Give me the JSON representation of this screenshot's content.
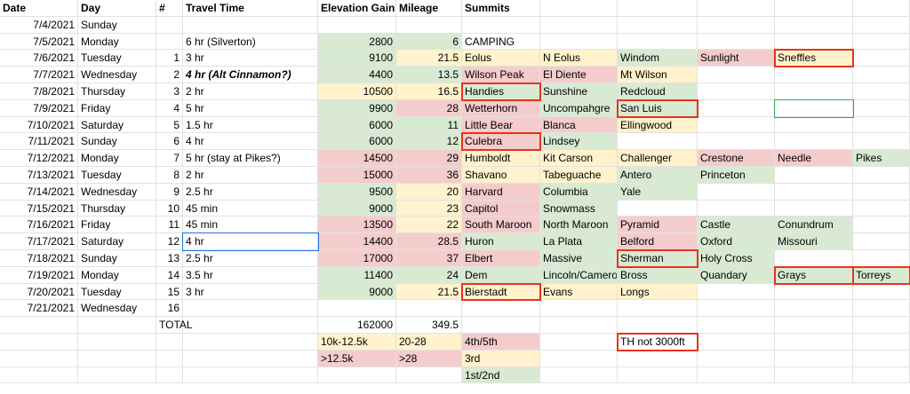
{
  "colors": {
    "green": "#d9ead3",
    "yellow": "#fff2cc",
    "red": "#f4cccc",
    "highlight_border": "#e8321f",
    "selected_border": "#1a73e8",
    "empty_box_border": "#34a853"
  },
  "headers": [
    "Date",
    "Day",
    "#",
    "Travel Time",
    "Elevation Gain",
    "Mileage",
    "Summits"
  ],
  "rows": [
    {
      "date": "7/4/2021",
      "day": "Sunday",
      "n": "",
      "travel": "",
      "elev": "",
      "miles": "",
      "summits": []
    },
    {
      "date": "7/5/2021",
      "day": "Monday",
      "n": "",
      "travel": "6 hr (Silverton)",
      "elev": "2800",
      "elev_c": "green",
      "miles": "6",
      "miles_c": "green",
      "summits": [
        {
          "t": "CAMPING",
          "c": ""
        }
      ]
    },
    {
      "date": "7/6/2021",
      "day": "Tuesday",
      "n": "1",
      "travel": "3 hr",
      "elev": "9100",
      "elev_c": "green",
      "miles": "21.5",
      "miles_c": "yellow",
      "summits": [
        {
          "t": "Eolus",
          "c": "yellow"
        },
        {
          "t": "N Eolus",
          "c": "yellow"
        },
        {
          "t": "Windom",
          "c": "green"
        },
        {
          "t": "Sunlight",
          "c": "red"
        },
        {
          "t": "Sneffles",
          "c": "yellow",
          "box": true
        }
      ]
    },
    {
      "date": "7/7/2021",
      "day": "Wednesday",
      "n": "2",
      "travel": "4 hr (Alt Cinnamon?)",
      "travel_bi": true,
      "elev": "4400",
      "elev_c": "green",
      "miles": "13.5",
      "miles_c": "green",
      "summits": [
        {
          "t": "Wilson Peak",
          "c": "red"
        },
        {
          "t": "El Diente",
          "c": "red"
        },
        {
          "t": "Mt Wilson",
          "c": "yellow"
        }
      ]
    },
    {
      "date": "7/8/2021",
      "day": "Thursday",
      "n": "3",
      "travel": "2 hr",
      "elev": "10500",
      "elev_c": "yellow",
      "miles": "16.5",
      "miles_c": "yellow",
      "summits": [
        {
          "t": "Handies",
          "c": "green",
          "box": true
        },
        {
          "t": "Sunshine",
          "c": "green"
        },
        {
          "t": "Redcloud",
          "c": "green"
        }
      ]
    },
    {
      "date": "7/9/2021",
      "day": "Friday",
      "n": "4",
      "travel": "5 hr",
      "elev": "9900",
      "elev_c": "green",
      "miles": "28",
      "miles_c": "red",
      "summits": [
        {
          "t": "Wetterhorn",
          "c": "red"
        },
        {
          "t": "Uncompahgre",
          "c": "green"
        },
        {
          "t": "San Luis",
          "c": "green",
          "box": true
        },
        {
          "t": "",
          "c": ""
        },
        {
          "t": "",
          "c": "",
          "gbox": true
        }
      ]
    },
    {
      "date": "7/10/2021",
      "day": "Saturday",
      "n": "5",
      "travel": "1.5 hr",
      "elev": "6000",
      "elev_c": "green",
      "miles": "11",
      "miles_c": "green",
      "summits": [
        {
          "t": "Little Bear",
          "c": "red"
        },
        {
          "t": "Blanca",
          "c": "red"
        },
        {
          "t": "Ellingwood",
          "c": "yellow"
        }
      ]
    },
    {
      "date": "7/11/2021",
      "day": "Sunday",
      "n": "6",
      "travel": "4 hr",
      "elev": "6000",
      "elev_c": "green",
      "miles": "12",
      "miles_c": "green",
      "summits": [
        {
          "t": "Culebra",
          "c": "red",
          "box": true
        },
        {
          "t": "Lindsey",
          "c": "green"
        }
      ]
    },
    {
      "date": "7/12/2021",
      "day": "Monday",
      "n": "7",
      "travel": "5 hr (stay at Pikes?)",
      "elev": "14500",
      "elev_c": "red",
      "miles": "29",
      "miles_c": "red",
      "summits": [
        {
          "t": "Humboldt",
          "c": "yellow"
        },
        {
          "t": "Kit Carson",
          "c": "yellow"
        },
        {
          "t": "Challenger",
          "c": "yellow"
        },
        {
          "t": "Crestone",
          "c": "red"
        },
        {
          "t": "Needle",
          "c": "red"
        },
        {
          "t": "Pikes",
          "c": "green"
        }
      ]
    },
    {
      "date": "7/13/2021",
      "day": "Tuesday",
      "n": "8",
      "travel": "2 hr",
      "elev": "15000",
      "elev_c": "red",
      "miles": "36",
      "miles_c": "red",
      "summits": [
        {
          "t": "Shavano",
          "c": "yellow"
        },
        {
          "t": "Tabeguache",
          "c": "yellow"
        },
        {
          "t": "Antero",
          "c": "green"
        },
        {
          "t": "Princeton",
          "c": "green"
        }
      ]
    },
    {
      "date": "7/14/2021",
      "day": "Wednesday",
      "n": "9",
      "travel": "2.5 hr",
      "elev": "9500",
      "elev_c": "green",
      "miles": "20",
      "miles_c": "yellow",
      "summits": [
        {
          "t": "Harvard",
          "c": "red"
        },
        {
          "t": "Columbia",
          "c": "green"
        },
        {
          "t": "Yale",
          "c": "green"
        }
      ]
    },
    {
      "date": "7/15/2021",
      "day": "Thursday",
      "n": "10",
      "travel": "45 min",
      "elev": "9000",
      "elev_c": "green",
      "miles": "23",
      "miles_c": "yellow",
      "summits": [
        {
          "t": "Capitol",
          "c": "red"
        },
        {
          "t": "Snowmass",
          "c": "green"
        }
      ]
    },
    {
      "date": "7/16/2021",
      "day": "Friday",
      "n": "11",
      "travel": "45 min",
      "elev": "13500",
      "elev_c": "red",
      "miles": "22",
      "miles_c": "yellow",
      "summits": [
        {
          "t": "South Maroon",
          "c": "red"
        },
        {
          "t": "North Maroon",
          "c": "green"
        },
        {
          "t": "Pyramid",
          "c": "red"
        },
        {
          "t": "Castle",
          "c": "green"
        },
        {
          "t": "Conundrum",
          "c": "green"
        }
      ]
    },
    {
      "date": "7/17/2021",
      "day": "Saturday",
      "n": "12",
      "travel": "4 hr",
      "travel_sel": true,
      "elev": "14400",
      "elev_c": "red",
      "miles": "28.5",
      "miles_c": "red",
      "summits": [
        {
          "t": "Huron",
          "c": "green"
        },
        {
          "t": "La Plata",
          "c": "green"
        },
        {
          "t": "Belford",
          "c": "red"
        },
        {
          "t": "Oxford",
          "c": "green"
        },
        {
          "t": "Missouri",
          "c": "green"
        }
      ]
    },
    {
      "date": "7/18/2021",
      "day": "Sunday",
      "n": "13",
      "travel": "2.5 hr",
      "elev": "17000",
      "elev_c": "red",
      "miles": "37",
      "miles_c": "red",
      "summits": [
        {
          "t": "Elbert",
          "c": "red"
        },
        {
          "t": "Massive",
          "c": "green"
        },
        {
          "t": "Sherman",
          "c": "green",
          "box": true
        },
        {
          "t": "Holy Cross",
          "c": "green"
        }
      ]
    },
    {
      "date": "7/19/2021",
      "day": "Monday",
      "n": "14",
      "travel": "3.5 hr",
      "elev": "11400",
      "elev_c": "green",
      "miles": "24",
      "miles_c": "green",
      "summits": [
        {
          "t": "Dem",
          "c": "green"
        },
        {
          "t": "Lincoln/Cameron",
          "c": "green"
        },
        {
          "t": "Bross",
          "c": "green"
        },
        {
          "t": "Quandary",
          "c": "green"
        },
        {
          "t": "Grays",
          "c": "green",
          "box": true
        },
        {
          "t": "Torreys",
          "c": "green",
          "box": true
        }
      ]
    },
    {
      "date": "7/20/2021",
      "day": "Tuesday",
      "n": "15",
      "travel": "3 hr",
      "elev": "9000",
      "elev_c": "green",
      "miles": "21.5",
      "miles_c": "yellow",
      "summits": [
        {
          "t": "Bierstadt",
          "c": "yellow",
          "box": true
        },
        {
          "t": "Evans",
          "c": "yellow"
        },
        {
          "t": "Longs",
          "c": "yellow"
        }
      ]
    },
    {
      "date": "7/21/2021",
      "day": "Wednesday",
      "n": "16",
      "travel": "",
      "elev": "",
      "miles": "",
      "summits": []
    }
  ],
  "total": {
    "label": "TOTAL",
    "elev": "162000",
    "miles": "349.5"
  },
  "legend": {
    "elev": [
      {
        "t": "10k-12.5k",
        "c": "yellow"
      },
      {
        "t": ">12.5k",
        "c": "red"
      }
    ],
    "miles": [
      {
        "t": "20-28",
        "c": "yellow"
      },
      {
        "t": ">28",
        "c": "red"
      }
    ],
    "summits": [
      {
        "t": "4th/5th",
        "c": "red"
      },
      {
        "t": "3rd",
        "c": "yellow"
      },
      {
        "t": "1st/2nd",
        "c": "green"
      }
    ],
    "note": "TH not 3000ft"
  }
}
